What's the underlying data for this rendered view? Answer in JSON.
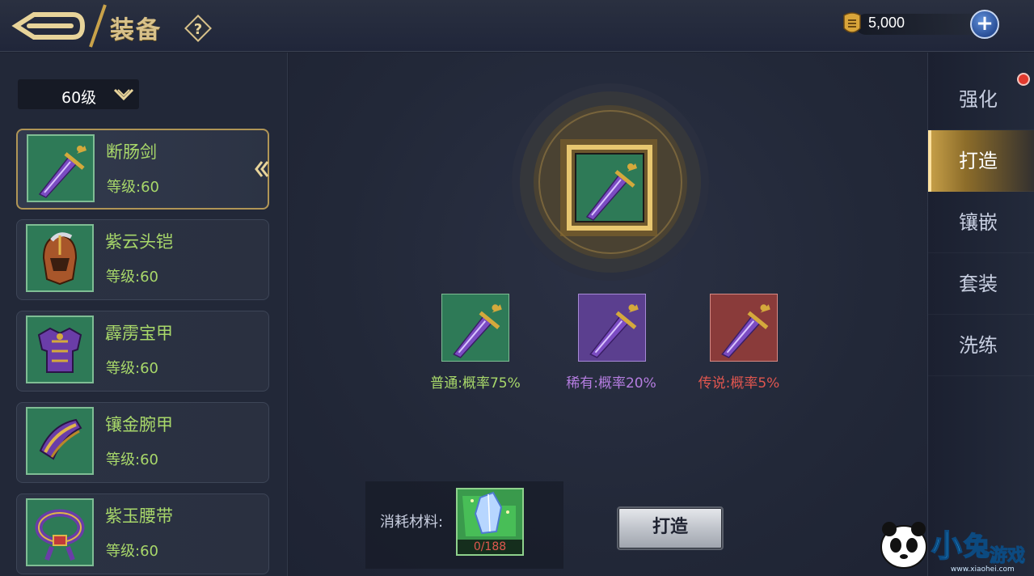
{
  "header": {
    "title": "装备",
    "help_symbol": "?",
    "currency": {
      "value": "5,000",
      "add_symbol": "+"
    }
  },
  "sidebar": {
    "level_select": "60级",
    "items": [
      {
        "name": "断肠剑",
        "level": "等级:60",
        "icon": "sword-icon",
        "selected": true
      },
      {
        "name": "紫云头铠",
        "level": "等级:60",
        "icon": "helmet-icon",
        "selected": false
      },
      {
        "name": "霹雳宝甲",
        "level": "等级:60",
        "icon": "armor-icon",
        "selected": false
      },
      {
        "name": "镶金腕甲",
        "level": "等级:60",
        "icon": "bracer-icon",
        "selected": false
      },
      {
        "name": "紫玉腰带",
        "level": "等级:60",
        "icon": "belt-icon",
        "selected": false
      }
    ]
  },
  "forge": {
    "results": [
      {
        "label": "普通:概率75%",
        "color": "#a8d86a",
        "bg": "#2e7a57",
        "border": "#7fbd94"
      },
      {
        "label": "稀有:概率20%",
        "color": "#b57de0",
        "bg": "#5b3f8f",
        "border": "#a689d6"
      },
      {
        "label": "传说:概率5%",
        "color": "#e0564f",
        "bg": "#8a3b3a",
        "border": "#d68a84"
      }
    ],
    "material_label": "消耗材料:",
    "material_count": "0/188",
    "button_label": "打造"
  },
  "tabs": [
    {
      "label": "强化",
      "active": false,
      "has_dot": true
    },
    {
      "label": "打造",
      "active": true,
      "has_dot": false
    },
    {
      "label": "镶嵌",
      "active": false,
      "has_dot": false
    },
    {
      "label": "套装",
      "active": false,
      "has_dot": false
    },
    {
      "label": "洗练",
      "active": false,
      "has_dot": false
    }
  ],
  "watermark": {
    "text": "小兔游戏",
    "url": "www.xiaohei.com"
  },
  "colors": {
    "accent_gold": "#c9a24a",
    "common_green": "#a8d86a",
    "rare_purple": "#b57de0",
    "legend_red": "#e0564f"
  }
}
